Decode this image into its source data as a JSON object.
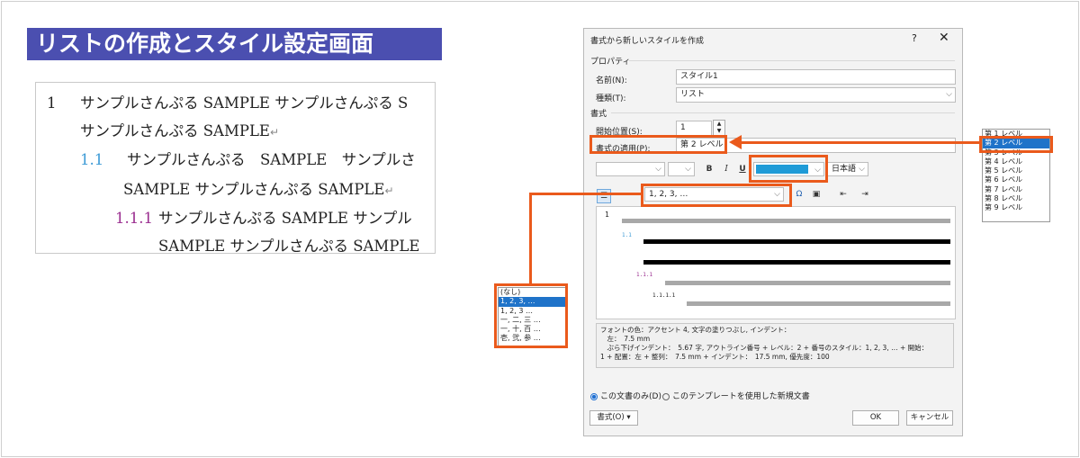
{
  "title": "リストの作成とスタイル設定画面",
  "doc": {
    "lines": [
      {
        "num": "1",
        "text": "サンプルさんぷる SAMPLE サンプルさんぷる S",
        "ret": ""
      },
      {
        "num": "",
        "text": "サンプルさんぷる SAMPLE",
        "ret": "↵"
      },
      {
        "num": "1.1",
        "text": "サンプルさんぷる　SAMPLE　サンプルさ",
        "ret": ""
      },
      {
        "num": "",
        "text": "SAMPLE サンプルさんぷる SAMPLE",
        "ret": "↵"
      },
      {
        "num": "1.1.1",
        "text": "サンプルさんぷる SAMPLE サンプル",
        "ret": ""
      },
      {
        "num": "",
        "text": "SAMPLE サンプルさんぷる SAMPLE",
        "ret": ""
      }
    ]
  },
  "dialog": {
    "title": "書式から新しいスタイルを作成",
    "help": "?",
    "close": "✕",
    "section_properties": "プロパティ",
    "name_label": "名前(N):",
    "name_value": "スタイル1",
    "type_label": "種類(T):",
    "type_value": "リスト",
    "section_format": "書式",
    "start_label": "開始位置(S):",
    "start_value": "1",
    "apply_label": "書式の適用(P):",
    "apply_value": "第 2 レベル",
    "bold": "B",
    "italic": "I",
    "underline": "U",
    "lang_value": "日本語",
    "number_style_value": "1, 2, 3, …",
    "omega": "Ω",
    "preview_nums": [
      "1",
      "1.1",
      "1.1.1",
      "1.1.1.1"
    ],
    "description": [
      "フォントの色：アクセント 4, 文字の塗りつぶし, インデント：",
      "　左：　7.5 mm",
      "　ぶら下げインデント：　5.67 字, アウトライン番号 + レベル：2 + 番号のスタイル：1, 2, 3, … + 開始：",
      "1 + 配置：左 + 整列：　7.5 mm + インデント：　17.5 mm, 優先度：100"
    ],
    "radio_doc_only": "この文書のみ(D)",
    "radio_template": "このテンプレートを使用した新規文書",
    "format_button": "書式(O) ▾",
    "ok": "OK",
    "cancel": "キャンセル"
  },
  "level_list": {
    "items": [
      "第 1 レベル",
      "第 2 レベル",
      "第 3 レベル",
      "第 4 レベル",
      "第 5 レベル",
      "第 6 レベル",
      "第 7 レベル",
      "第 8 レベル",
      "第 9 レベル"
    ],
    "selected": "第 2 レベル"
  },
  "number_list": {
    "items": [
      "(なし)",
      "1, 2, 3, …",
      "1, 2, 3 …",
      "一, 二, 三 …",
      "一, 十, 百 …",
      "壱, 弐, 参 …"
    ],
    "selected": "1, 2, 3, …"
  },
  "colors": {
    "accent": "#4b4fb0",
    "highlight": "#ea5a1c",
    "font_color": "#1f9bd7",
    "level2_num": "#3c9ad6",
    "level3_num": "#9a2d8f"
  }
}
